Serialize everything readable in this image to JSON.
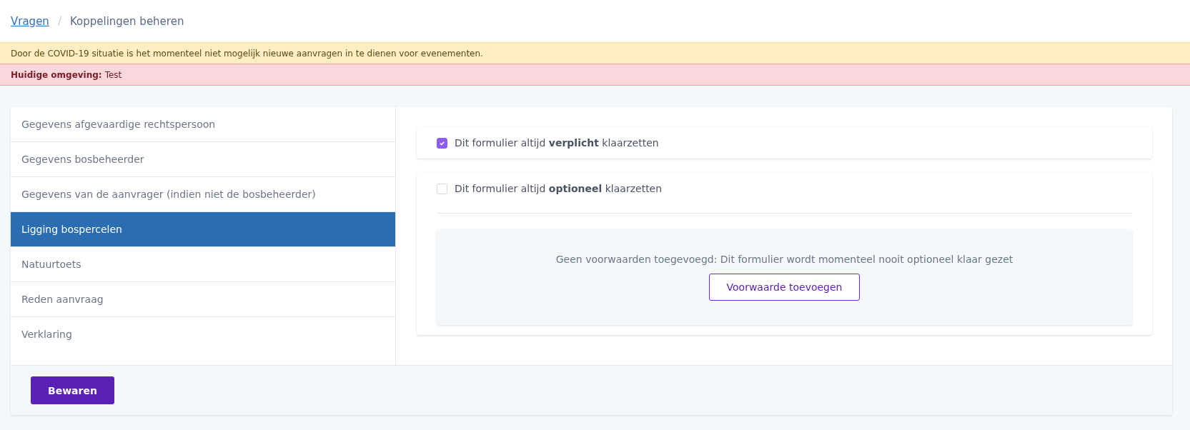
{
  "breadcrumb": {
    "link": "Vragen",
    "separator": "/",
    "current": "Koppelingen beheren"
  },
  "notices": [
    {
      "kind": "warning",
      "text": "Door de COVID-19 situatie is het momenteel niet mogelijk nieuwe aanvragen in te dienen voor evenementen."
    },
    {
      "kind": "danger",
      "label": "Huidige omgeving:",
      "text": "Test"
    }
  ],
  "sidebar": {
    "items": [
      {
        "label": "Gegevens afgevaardige rechtspersoon",
        "selected": false
      },
      {
        "label": "Gegevens bosbeheerder",
        "selected": false
      },
      {
        "label": "Gegevens van de aanvrager (indien niet de bosbeheerder)",
        "selected": false
      },
      {
        "label": "Ligging bospercelen",
        "selected": true
      },
      {
        "label": "Natuurtoets",
        "selected": false
      },
      {
        "label": "Reden aanvraag",
        "selected": false
      },
      {
        "label": "Verklaring",
        "selected": false
      }
    ]
  },
  "options": [
    {
      "label": "Dit formulier altijd **verplicht** klaarzetten",
      "checked": true
    },
    {
      "label": "Dit formulier altijd **optioneel** klaarzetten",
      "checked": false,
      "empty_message": "Geen voorwaarden toegevoegd: Dit formulier wordt momenteel nooit optioneel klaar gezet",
      "add_button": "Voorwaarde toevoegen"
    }
  ],
  "save_button": "Bewaren"
}
